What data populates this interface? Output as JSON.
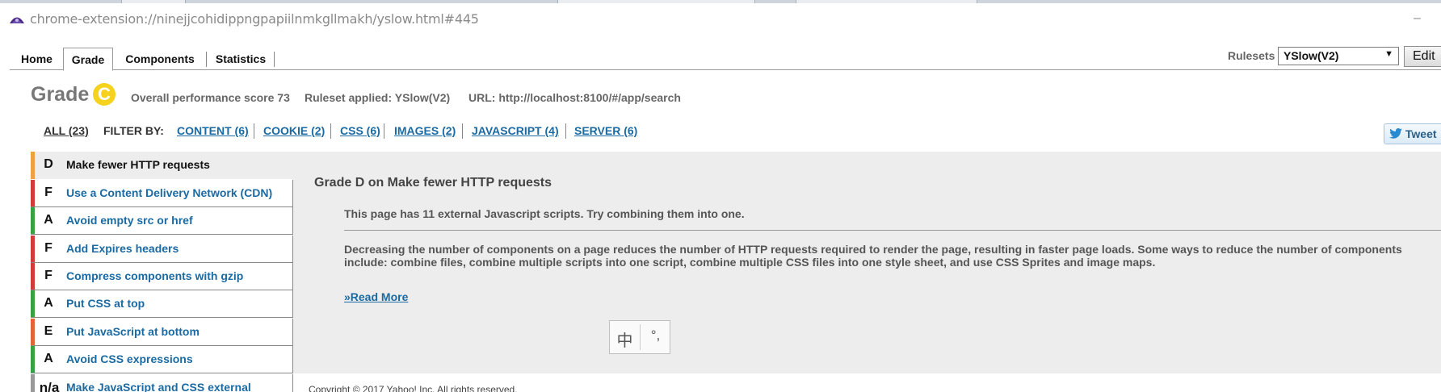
{
  "window": {
    "url": "chrome-extension://ninejjcohidippngpapiilnmkgllmakh/yslow.html#445",
    "minimize_glyph": "–"
  },
  "tabs": [
    {
      "label": "Home"
    },
    {
      "label": "Grade"
    },
    {
      "label": "Components"
    },
    {
      "label": "Statistics"
    }
  ],
  "rulesets": {
    "label": "Rulesets",
    "selected": "YSlow(V2)",
    "edit_label": "Edit"
  },
  "grade": {
    "title": "Grade",
    "letter": "C",
    "badge_color": "#f5d21e",
    "overall": "Overall performance score 73",
    "ruleset_applied": "Ruleset applied: YSlow(V2)",
    "url": "URL: http://localhost:8100/#/app/search"
  },
  "filters": {
    "all": "ALL (23)",
    "filter_by": "FILTER BY:",
    "items": [
      {
        "label": "CONTENT (6)"
      },
      {
        "label": "COOKIE (2)"
      },
      {
        "label": "CSS (6)"
      },
      {
        "label": "IMAGES (2)"
      },
      {
        "label": "JAVASCRIPT (4)"
      },
      {
        "label": "SERVER (6)"
      }
    ]
  },
  "tweet": {
    "label": "Tweet"
  },
  "rules": [
    {
      "grade": "D",
      "label": "Make fewer HTTP requests",
      "color": "#f0a040",
      "active": true
    },
    {
      "grade": "F",
      "label": "Use a Content Delivery Network (CDN)",
      "color": "#d33b3b"
    },
    {
      "grade": "A",
      "label": "Avoid empty src or href",
      "color": "#3aa043"
    },
    {
      "grade": "F",
      "label": "Add Expires headers",
      "color": "#d33b3b"
    },
    {
      "grade": "F",
      "label": "Compress components with gzip",
      "color": "#d33b3b"
    },
    {
      "grade": "A",
      "label": "Put CSS at top",
      "color": "#3aa043"
    },
    {
      "grade": "E",
      "label": "Put JavaScript at bottom",
      "color": "#e2633c"
    },
    {
      "grade": "A",
      "label": "Avoid CSS expressions",
      "color": "#3aa043"
    },
    {
      "grade": "n/a",
      "label": "Make JavaScript and CSS external",
      "color": "#999999"
    }
  ],
  "detail": {
    "title": "Grade D on Make fewer HTTP requests",
    "message": "This page has 11 external Javascript scripts. Try combining them into one.",
    "description": "Decreasing the number of components on a page reduces the number of HTTP requests required to render the page, resulting in faster page loads. Some ways to reduce the number of components include: combine files, combine multiple scripts into one script, combine multiple CSS files into one style sheet, and use CSS Sprites and image maps.",
    "read_more": "»Read More"
  },
  "ime": {
    "left": "中",
    "right": "°,"
  },
  "footer": {
    "copyright": "Copyright © 2017 Yahoo! Inc. All rights reserved."
  }
}
